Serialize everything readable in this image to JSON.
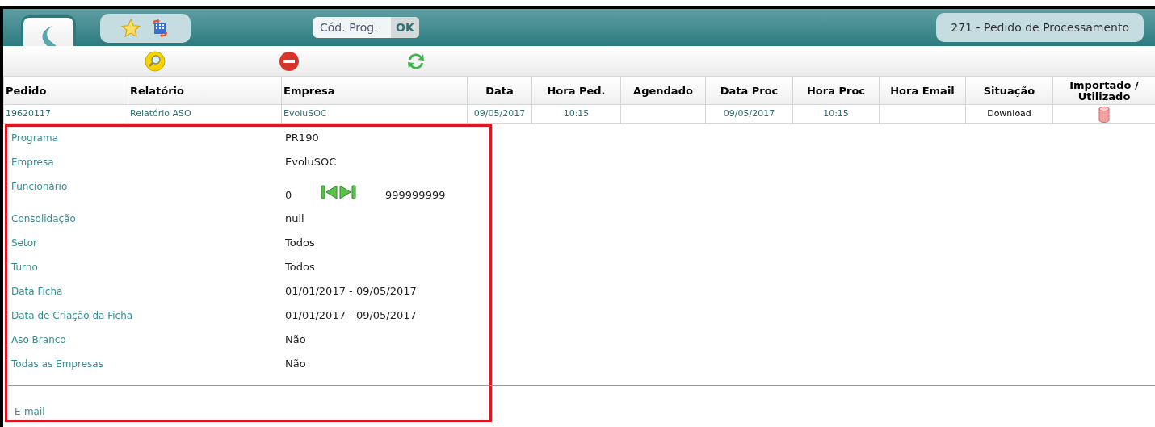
{
  "header": {
    "code_field": {
      "placeholder": "Cód. Prog."
    },
    "ok_button": "OK",
    "page_title": "271 - Pedido de Processamento"
  },
  "table": {
    "columns": [
      "Pedido",
      "Relatório",
      "Empresa",
      "Data",
      "Hora Ped.",
      "Agendado",
      "Data Proc",
      "Hora Proc",
      "Hora Email",
      "Situação",
      "Importado / Utilizado"
    ],
    "rows": [
      {
        "cells": [
          "19620117",
          "Relatório ASO",
          "EvoluSOC",
          "09/05/2017",
          "10:15",
          "",
          "09/05/2017",
          "10:15",
          "",
          "Download",
          ""
        ]
      }
    ]
  },
  "details": [
    {
      "kind": "text",
      "label": "Programa",
      "value": "PR190"
    },
    {
      "kind": "text",
      "label": "Empresa",
      "value": "EvoluSOC"
    },
    {
      "kind": "range",
      "label": "Funcionário",
      "from": "0",
      "to": "999999999"
    },
    {
      "kind": "text",
      "label": "Consolidação",
      "value": "null"
    },
    {
      "kind": "text",
      "label": "Setor",
      "value": "Todos"
    },
    {
      "kind": "text",
      "label": "Turno",
      "value": "Todos"
    },
    {
      "kind": "text",
      "label": "Data Ficha",
      "value": "01/01/2017 - 09/05/2017"
    },
    {
      "kind": "text",
      "label": "Data de Criação da Ficha",
      "value": "01/01/2017 - 09/05/2017"
    },
    {
      "kind": "text",
      "label": "Aso Branco",
      "value": "Não"
    },
    {
      "kind": "text",
      "label": "Todas as Empresas",
      "value": "Não"
    }
  ],
  "email": {
    "label": "E-mail"
  }
}
